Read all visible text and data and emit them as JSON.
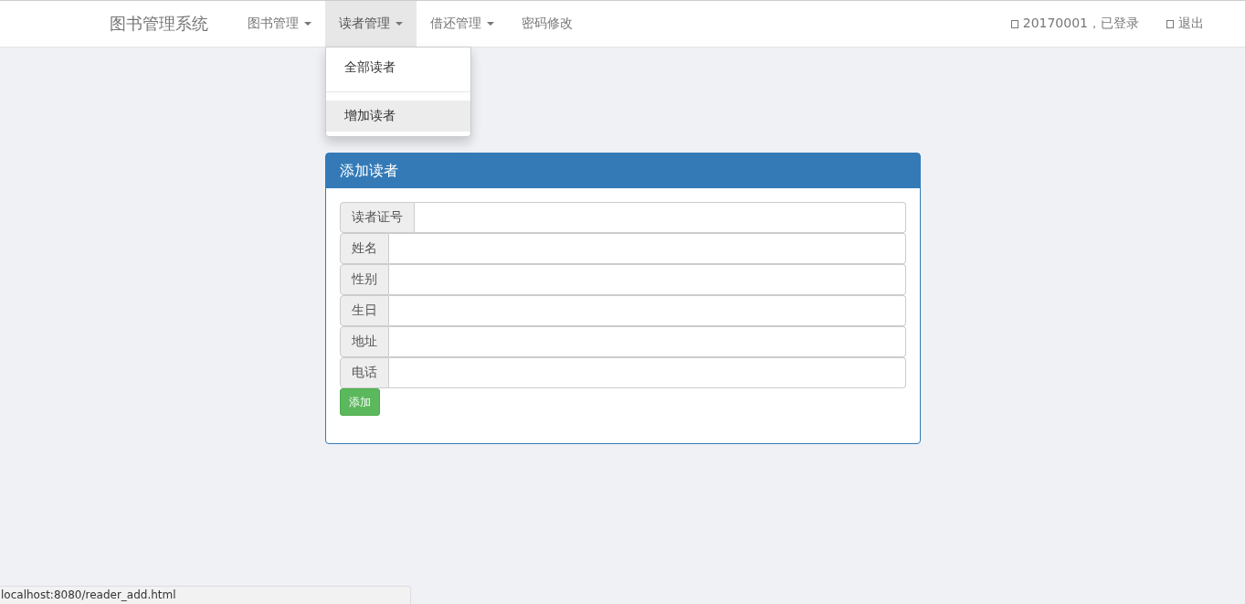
{
  "navbar": {
    "brand": "图书管理系统",
    "items": [
      {
        "label": "图书管理",
        "dropdown": true,
        "selected": false
      },
      {
        "label": "读者管理",
        "dropdown": true,
        "selected": true
      },
      {
        "label": "借还管理",
        "dropdown": true,
        "selected": false
      },
      {
        "label": "密码修改",
        "dropdown": false,
        "selected": false
      }
    ],
    "user": "20170001，已登录",
    "logout": "退出"
  },
  "dropdown_menu": {
    "items": [
      {
        "label": "全部读者",
        "selected": false
      },
      {
        "label": "增加读者",
        "selected": true
      }
    ]
  },
  "panel": {
    "title": "添加读者",
    "fields": [
      {
        "label": "读者证号"
      },
      {
        "label": "姓名"
      },
      {
        "label": "性别"
      },
      {
        "label": "生日"
      },
      {
        "label": "地址"
      },
      {
        "label": "电话"
      }
    ],
    "submit": "添加"
  },
  "status_bar": {
    "url": "localhost:8080/reader_add.html"
  }
}
